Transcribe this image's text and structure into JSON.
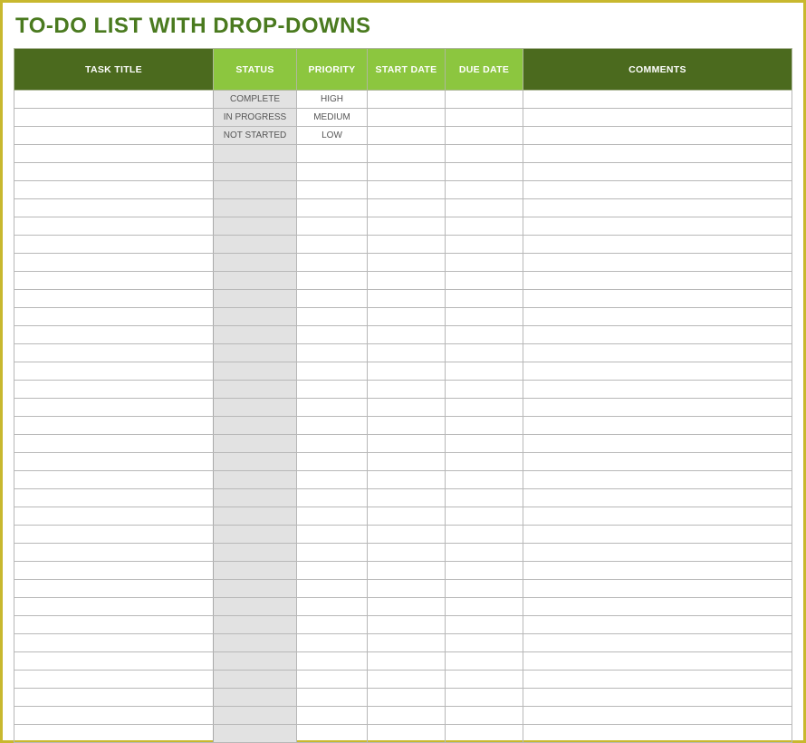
{
  "title": "TO-DO LIST WITH DROP-DOWNS",
  "headers": {
    "task": "TASK TITLE",
    "status": "STATUS",
    "priority": "PRIORITY",
    "start": "START DATE",
    "due": "DUE DATE",
    "comments": "COMMENTS"
  },
  "rows": [
    {
      "task": "",
      "status": "COMPLETE",
      "priority": "HIGH",
      "start": "",
      "due": "",
      "comments": ""
    },
    {
      "task": "",
      "status": "IN PROGRESS",
      "priority": "MEDIUM",
      "start": "",
      "due": "",
      "comments": ""
    },
    {
      "task": "",
      "status": "NOT STARTED",
      "priority": "LOW",
      "start": "",
      "due": "",
      "comments": ""
    },
    {
      "task": "",
      "status": "",
      "priority": "",
      "start": "",
      "due": "",
      "comments": ""
    },
    {
      "task": "",
      "status": "",
      "priority": "",
      "start": "",
      "due": "",
      "comments": ""
    },
    {
      "task": "",
      "status": "",
      "priority": "",
      "start": "",
      "due": "",
      "comments": ""
    },
    {
      "task": "",
      "status": "",
      "priority": "",
      "start": "",
      "due": "",
      "comments": ""
    },
    {
      "task": "",
      "status": "",
      "priority": "",
      "start": "",
      "due": "",
      "comments": ""
    },
    {
      "task": "",
      "status": "",
      "priority": "",
      "start": "",
      "due": "",
      "comments": ""
    },
    {
      "task": "",
      "status": "",
      "priority": "",
      "start": "",
      "due": "",
      "comments": ""
    },
    {
      "task": "",
      "status": "",
      "priority": "",
      "start": "",
      "due": "",
      "comments": ""
    },
    {
      "task": "",
      "status": "",
      "priority": "",
      "start": "",
      "due": "",
      "comments": ""
    },
    {
      "task": "",
      "status": "",
      "priority": "",
      "start": "",
      "due": "",
      "comments": ""
    },
    {
      "task": "",
      "status": "",
      "priority": "",
      "start": "",
      "due": "",
      "comments": ""
    },
    {
      "task": "",
      "status": "",
      "priority": "",
      "start": "",
      "due": "",
      "comments": ""
    },
    {
      "task": "",
      "status": "",
      "priority": "",
      "start": "",
      "due": "",
      "comments": ""
    },
    {
      "task": "",
      "status": "",
      "priority": "",
      "start": "",
      "due": "",
      "comments": ""
    },
    {
      "task": "",
      "status": "",
      "priority": "",
      "start": "",
      "due": "",
      "comments": ""
    },
    {
      "task": "",
      "status": "",
      "priority": "",
      "start": "",
      "due": "",
      "comments": ""
    },
    {
      "task": "",
      "status": "",
      "priority": "",
      "start": "",
      "due": "",
      "comments": ""
    },
    {
      "task": "",
      "status": "",
      "priority": "",
      "start": "",
      "due": "",
      "comments": ""
    },
    {
      "task": "",
      "status": "",
      "priority": "",
      "start": "",
      "due": "",
      "comments": ""
    },
    {
      "task": "",
      "status": "",
      "priority": "",
      "start": "",
      "due": "",
      "comments": ""
    },
    {
      "task": "",
      "status": "",
      "priority": "",
      "start": "",
      "due": "",
      "comments": ""
    },
    {
      "task": "",
      "status": "",
      "priority": "",
      "start": "",
      "due": "",
      "comments": ""
    },
    {
      "task": "",
      "status": "",
      "priority": "",
      "start": "",
      "due": "",
      "comments": ""
    },
    {
      "task": "",
      "status": "",
      "priority": "",
      "start": "",
      "due": "",
      "comments": ""
    },
    {
      "task": "",
      "status": "",
      "priority": "",
      "start": "",
      "due": "",
      "comments": ""
    },
    {
      "task": "",
      "status": "",
      "priority": "",
      "start": "",
      "due": "",
      "comments": ""
    },
    {
      "task": "",
      "status": "",
      "priority": "",
      "start": "",
      "due": "",
      "comments": ""
    },
    {
      "task": "",
      "status": "",
      "priority": "",
      "start": "",
      "due": "",
      "comments": ""
    },
    {
      "task": "",
      "status": "",
      "priority": "",
      "start": "",
      "due": "",
      "comments": ""
    },
    {
      "task": "",
      "status": "",
      "priority": "",
      "start": "",
      "due": "",
      "comments": ""
    },
    {
      "task": "",
      "status": "",
      "priority": "",
      "start": "",
      "due": "",
      "comments": ""
    },
    {
      "task": "",
      "status": "",
      "priority": "",
      "start": "",
      "due": "",
      "comments": ""
    },
    {
      "task": "",
      "status": "",
      "priority": "",
      "start": "",
      "due": "",
      "comments": ""
    }
  ]
}
